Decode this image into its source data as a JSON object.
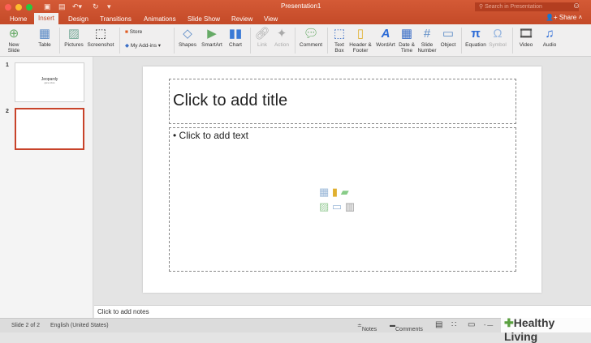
{
  "window": {
    "title": "Presentation1",
    "search_placeholder": "Search in Presentation",
    "share": "Share"
  },
  "quick_access": [
    "sidebar-icon",
    "save-icon",
    "undo-icon",
    "redo-icon",
    "customize-icon"
  ],
  "tabs": [
    {
      "label": "Home"
    },
    {
      "label": "Insert",
      "active": true
    },
    {
      "label": "Design"
    },
    {
      "label": "Transitions"
    },
    {
      "label": "Animations"
    },
    {
      "label": "Slide Show"
    },
    {
      "label": "Review"
    },
    {
      "label": "View"
    }
  ],
  "ribbon": {
    "new_slide": "New\nSlide",
    "table": "Table",
    "pictures": "Pictures",
    "screenshot": "Screenshot",
    "store": "Store",
    "my_addins": "My Add-ins",
    "shapes": "Shapes",
    "smartart": "SmartArt",
    "chart": "Chart",
    "link": "Link",
    "action": "Action",
    "comment": "Comment",
    "text_box": "Text\nBox",
    "header_footer": "Header &\nFooter",
    "wordart": "WordArt",
    "date_time": "Date &\nTime",
    "slide_number": "Slide\nNumber",
    "object": "Object",
    "equation": "Equation",
    "symbol": "Symbol",
    "video": "Video",
    "audio": "Audio"
  },
  "slides_pane": {
    "items": [
      {
        "number": "1",
        "title": "Jeopardy",
        "subtitle": "game show"
      },
      {
        "number": "2",
        "selected": true
      }
    ]
  },
  "slide": {
    "title_placeholder": "Click to add title",
    "body_placeholder": "Click to add text"
  },
  "notes": {
    "placeholder": "Click to add notes"
  },
  "status": {
    "slide": "Slide 2 of 2",
    "language": "English (United States)",
    "notes": "Notes",
    "comments": "Comments"
  },
  "watermark": "Healthy Living",
  "colors": {
    "accent": "#c44a28",
    "selected_border": "#c8432a"
  }
}
